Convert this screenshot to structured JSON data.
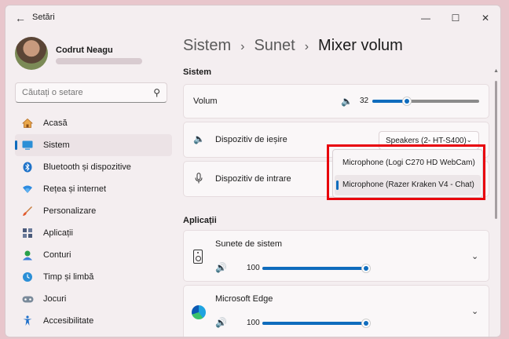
{
  "window": {
    "title": "Setări"
  },
  "profile": {
    "name": "Codrut Neagu"
  },
  "search": {
    "placeholder": "Căutați o setare"
  },
  "sidebar": {
    "items": [
      {
        "label": "Acasă",
        "icon": "home-icon"
      },
      {
        "label": "Sistem",
        "icon": "system-icon",
        "selected": true
      },
      {
        "label": "Bluetooth și dispozitive",
        "icon": "bluetooth-icon"
      },
      {
        "label": "Rețea și internet",
        "icon": "wifi-icon"
      },
      {
        "label": "Personalizare",
        "icon": "brush-icon"
      },
      {
        "label": "Aplicații",
        "icon": "apps-icon"
      },
      {
        "label": "Conturi",
        "icon": "account-icon"
      },
      {
        "label": "Timp și limbă",
        "icon": "clock-globe-icon"
      },
      {
        "label": "Jocuri",
        "icon": "gamepad-icon"
      },
      {
        "label": "Accesibilitate",
        "icon": "accessibility-icon"
      }
    ]
  },
  "breadcrumb": {
    "part1": "Sistem",
    "part2": "Sunet",
    "current": "Mixer volum"
  },
  "system_section": {
    "title": "Sistem",
    "volume": {
      "label": "Volum",
      "value": "32",
      "level": 32
    },
    "output": {
      "label": "Dispozitiv de ieșire",
      "selected": "Speakers (2- HT-S400)"
    },
    "input": {
      "label": "Dispozitiv de intrare",
      "options": [
        "Microphone (Logi C270 HD WebCam)",
        "Microphone (Razer Kraken V4 - Chat)"
      ],
      "selected_index": 1
    }
  },
  "apps_section": {
    "title": "Aplicații",
    "apps": [
      {
        "name": "Sunete de sistem",
        "volume": "100",
        "level": 100
      },
      {
        "name": "Microsoft Edge",
        "volume": "100",
        "level": 100
      }
    ]
  },
  "colors": {
    "accent": "#0f6cbd",
    "highlight": "#e8000b"
  }
}
